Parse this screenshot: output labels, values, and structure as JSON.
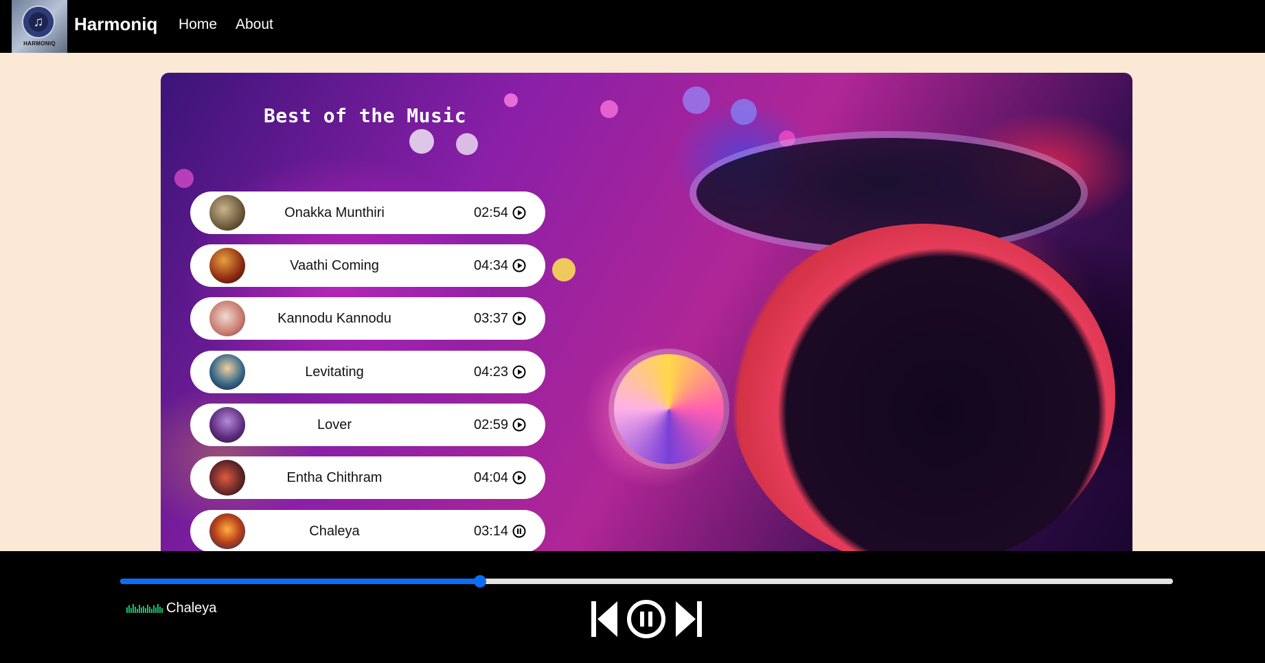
{
  "nav": {
    "brand": "Harmoniq",
    "logo_text": "HARMONIQ",
    "links": [
      "Home",
      "About"
    ]
  },
  "hero": {
    "title": "Best of the Music"
  },
  "songs": [
    {
      "title": "Onakka Munthiri",
      "duration": "02:54",
      "icon": "play-circle-icon"
    },
    {
      "title": "Vaathi Coming",
      "duration": "04:34",
      "icon": "play-circle-icon"
    },
    {
      "title": "Kannodu Kannodu",
      "duration": "03:37",
      "icon": "play-circle-icon"
    },
    {
      "title": "Levitating",
      "duration": "04:23",
      "icon": "play-circle-icon"
    },
    {
      "title": "Lover",
      "duration": "02:59",
      "icon": "play-circle-icon"
    },
    {
      "title": "Entha Chithram",
      "duration": "04:04",
      "icon": "play-circle-icon"
    },
    {
      "title": "Chaleya",
      "duration": "03:14",
      "icon": "pause-circle-icon"
    }
  ],
  "player": {
    "now_playing": "Chaleya",
    "progress_fraction": 0.342,
    "controls": [
      "previous-icon",
      "pause-circle-icon",
      "next-icon"
    ]
  },
  "colors": {
    "nav_bg": "#000000",
    "page_bg": "#fbe9d6",
    "accent": "#0c6ef5",
    "equalizer": "#19c26a"
  }
}
